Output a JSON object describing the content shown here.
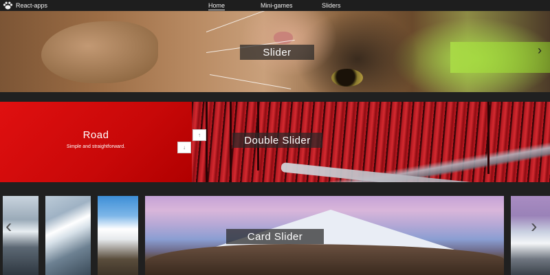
{
  "navbar": {
    "brand": "React-apps",
    "links": [
      {
        "label": "Home",
        "active": true
      },
      {
        "label": "Mini-games",
        "active": false
      },
      {
        "label": "Sliders",
        "active": false
      }
    ]
  },
  "slider": {
    "label": "Slider",
    "next_glyph": "›"
  },
  "double_slider": {
    "label": "Double Slider",
    "panel_title": "Road",
    "panel_subtitle": "Simple and straightforward.",
    "up_glyph": "↑",
    "down_glyph": "↓",
    "panel_color": "#d40808"
  },
  "card_slider": {
    "label": "Card Slider",
    "prev_glyph": "‹",
    "next_glyph": "›"
  },
  "colors": {
    "background": "#202020",
    "navbar": "#1e1e1e"
  },
  "icons": {
    "brand": "paw-icon",
    "next": "chevron-right-icon",
    "prev": "chevron-left-icon",
    "up": "arrow-up-icon",
    "down": "arrow-down-icon"
  }
}
